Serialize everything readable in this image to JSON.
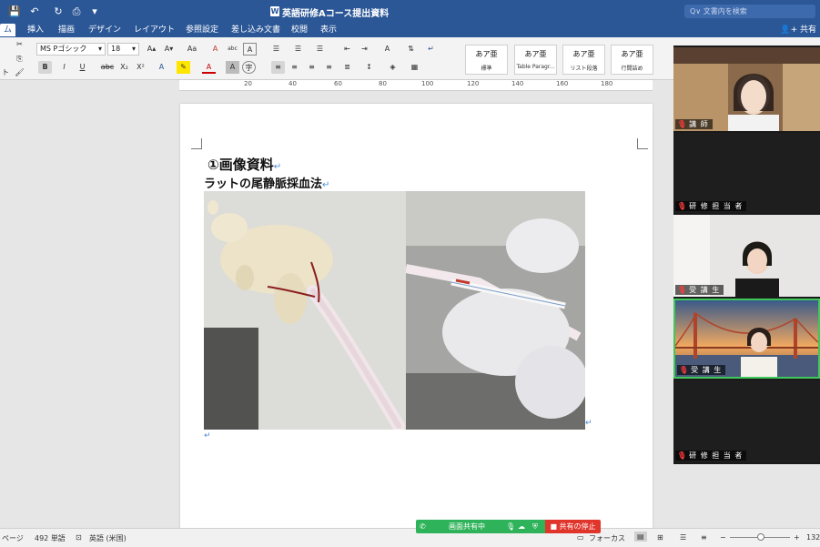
{
  "titlebar": {
    "doc_title": "英語研修Aコース提出資料",
    "doc_icon": "W",
    "save_icon": "💾",
    "undo_icon": "↶",
    "redo_icon": "↻",
    "print_icon": "⎙",
    "more_icon": "▾",
    "search_placeholder": "Q∨ 文書内を検索"
  },
  "menu": {
    "items": [
      "ム",
      "挿入",
      "描画",
      "デザイン",
      "レイアウト",
      "参照設定",
      "差し込み文書",
      "校閲",
      "表示"
    ],
    "share": "共有"
  },
  "ribbon": {
    "font_name": "MS Pゴシック",
    "font_size": "18",
    "bold": "B",
    "italic": "I",
    "underline": "U",
    "strike": "abc",
    "subscript": "X₂",
    "superscript": "X²",
    "grow": "A▴",
    "shrink": "A▾",
    "case": "Aa",
    "clear": "A",
    "abc": "abc",
    "font_a": "A",
    "highlight": "✎",
    "font_color": "A",
    "char_shade": "A",
    "enclose": "字",
    "paste_label": "ト",
    "styles": [
      {
        "preview": "あア亜",
        "name": "標準"
      },
      {
        "preview": "あア亜",
        "name": "Table Paragr..."
      },
      {
        "preview": "あア亜",
        "name": "リスト段落"
      },
      {
        "preview": "あア亜",
        "name": "行間詰め"
      }
    ]
  },
  "ruler": {
    "labels": [
      "20",
      "40",
      "60",
      "80",
      "100",
      "120",
      "140",
      "160",
      "180"
    ]
  },
  "document": {
    "heading1": "①画像資料",
    "heading2": "ラットの尾静脈採血法",
    "pilcrow": "↵"
  },
  "statusbar": {
    "page": "ページ",
    "words": "492 単語",
    "lang": "英語 (米国)",
    "focus": "フォーカス",
    "zoom_minus": "−",
    "zoom_plus": "+",
    "zoom_value": "132"
  },
  "share_bar": {
    "sharing": "画面共有中",
    "stop": "共有の停止"
  },
  "participants": [
    {
      "name": "講 師"
    },
    {
      "name": "研 修 担 当 者"
    },
    {
      "name": "受 講 生"
    },
    {
      "name": "受 講 生"
    },
    {
      "name": "研 修 担 当 者"
    }
  ],
  "colors": {
    "word_blue": "#2b5797",
    "share_green": "#2fb35a",
    "stop_red": "#e0352b",
    "active_speaker": "#3ec95a"
  }
}
